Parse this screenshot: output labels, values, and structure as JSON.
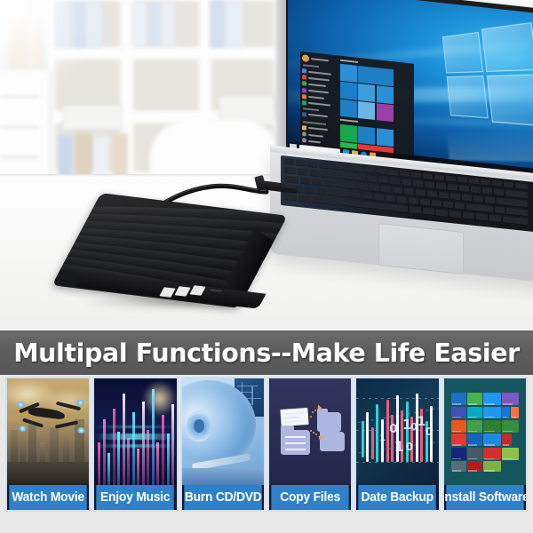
{
  "banner": {
    "title": "Multipal Functions--Make Life Easier",
    "background_color": "#5e5e5e",
    "text_color": "#ffffff"
  },
  "product": {
    "name": "External USB DVD Drive",
    "body_color": "#1a1a1c",
    "badges": [
      "CD-RW",
      "CD",
      "DVD"
    ]
  },
  "scene": {
    "laptop": {
      "os": "Windows 10",
      "screen_state": "start-menu-open",
      "chassis_color": "#d3d5d8",
      "wallpaper_color": "#1a8ed6"
    },
    "background": "blurred white office shelving with binders",
    "desk_color": "#f7f7f5"
  },
  "features": {
    "label_bar_color": "#2f80c8",
    "border_color": "#cfe0f0",
    "tiles": [
      {
        "label": "Watch Movie",
        "theme": "sci-fi-drone",
        "accent": "#b59a63"
      },
      {
        "label": "Enjoy Music",
        "theme": "audio-equalizer",
        "accent": "#e45fb0"
      },
      {
        "label": "Burn CD/DVD",
        "theme": "hard-disk-platter",
        "accent": "#6ba2d4"
      },
      {
        "label": "Copy Files",
        "theme": "file-folder-transfer",
        "accent": "#aeb6e0"
      },
      {
        "label": "Date Backup",
        "theme": "binary-data-chart",
        "accent": "#2fd3d3"
      },
      {
        "label": "Install Software",
        "theme": "windows-metro-tiles",
        "accent": "#15555e"
      }
    ]
  }
}
